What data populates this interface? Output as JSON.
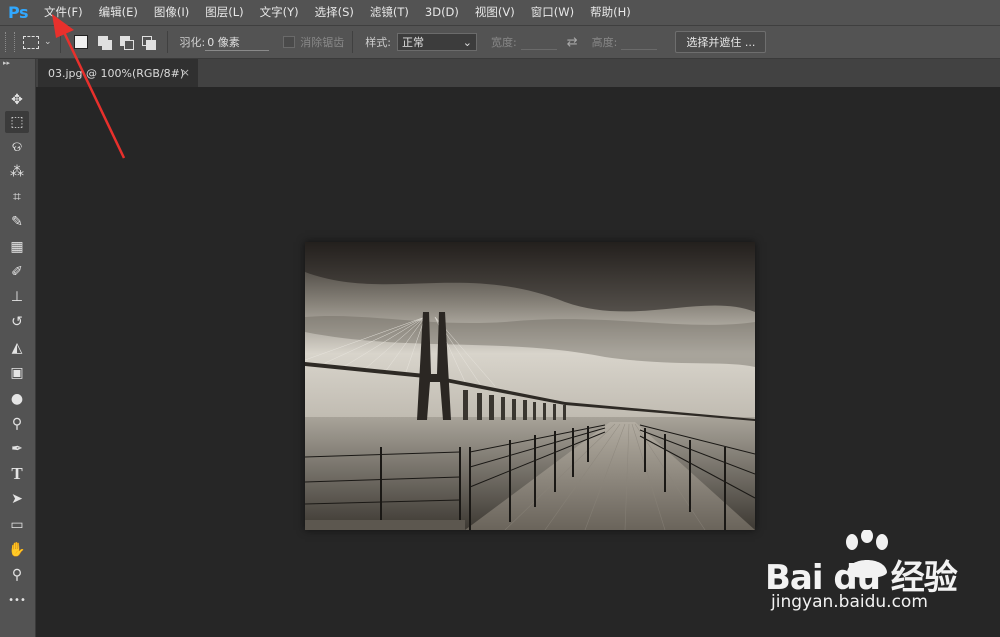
{
  "app": {
    "logo": "Ps"
  },
  "menu": [
    {
      "label": "文件(F)"
    },
    {
      "label": "编辑(E)"
    },
    {
      "label": "图像(I)"
    },
    {
      "label": "图层(L)"
    },
    {
      "label": "文字(Y)"
    },
    {
      "label": "选择(S)"
    },
    {
      "label": "滤镜(T)"
    },
    {
      "label": "3D(D)"
    },
    {
      "label": "视图(V)"
    },
    {
      "label": "窗口(W)"
    },
    {
      "label": "帮助(H)"
    }
  ],
  "options": {
    "feather_label": "羽化:",
    "feather_value": "0 像素",
    "antialias_label": "消除锯齿",
    "style_label": "样式:",
    "style_value": "正常",
    "width_label": "宽度:",
    "height_label": "高度:",
    "select_mask_button": "选择并遮住 ..."
  },
  "document": {
    "tab_title": "03.jpg @ 100%(RGB/8#)",
    "close_glyph": "×"
  },
  "tools": [
    {
      "name": "move-tool",
      "glyph": "✥"
    },
    {
      "name": "marquee-tool",
      "glyph": "⬚"
    },
    {
      "name": "lasso-tool",
      "glyph": "ଡ"
    },
    {
      "name": "quick-select-tool",
      "glyph": "⁂"
    },
    {
      "name": "crop-tool",
      "glyph": "⌗"
    },
    {
      "name": "eyedropper-tool",
      "glyph": "✎"
    },
    {
      "name": "healing-brush-tool",
      "glyph": "▦"
    },
    {
      "name": "brush-tool",
      "glyph": "✐"
    },
    {
      "name": "stamp-tool",
      "glyph": "⊥"
    },
    {
      "name": "history-brush-tool",
      "glyph": "↺"
    },
    {
      "name": "eraser-tool",
      "glyph": "◭"
    },
    {
      "name": "gradient-tool",
      "glyph": "▣"
    },
    {
      "name": "blur-tool",
      "glyph": "●"
    },
    {
      "name": "dodge-tool",
      "glyph": "⚲"
    },
    {
      "name": "pen-tool",
      "glyph": "✒"
    },
    {
      "name": "type-tool",
      "glyph": "T"
    },
    {
      "name": "path-select-tool",
      "glyph": "➤"
    },
    {
      "name": "shape-tool",
      "glyph": "▭"
    },
    {
      "name": "hand-tool",
      "glyph": "✋"
    },
    {
      "name": "zoom-tool",
      "glyph": "⚲"
    },
    {
      "name": "more-tools",
      "glyph": "•••"
    }
  ],
  "watermark": {
    "brand": "Bai du 经验",
    "url": "jingyan.baidu.com"
  },
  "colors": {
    "logo": "#31a8ff",
    "arrow": "#e8302c",
    "panel": "#535353",
    "workspace": "#262626"
  }
}
